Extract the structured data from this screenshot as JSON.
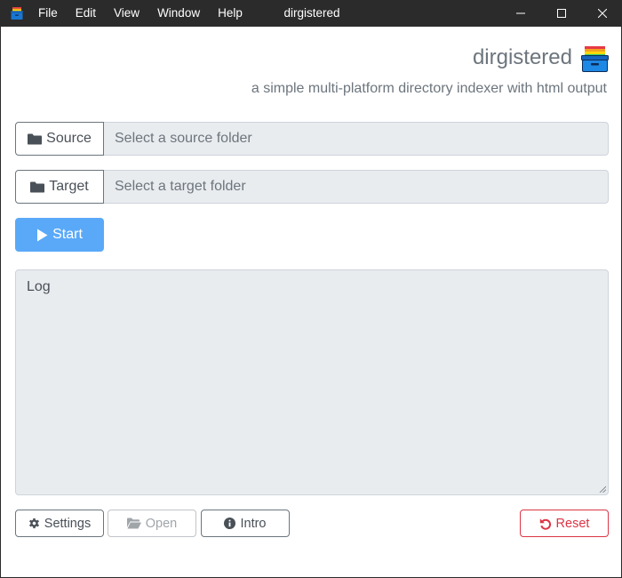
{
  "window": {
    "title": "dirgistered",
    "menu": [
      "File",
      "Edit",
      "View",
      "Window",
      "Help"
    ]
  },
  "header": {
    "app_name": "dirgistered",
    "subtitle": "a simple multi-platform directory indexer with html output"
  },
  "source": {
    "button_label": "Source",
    "placeholder": "Select a source folder"
  },
  "target": {
    "button_label": "Target",
    "placeholder": "Select a target folder"
  },
  "start": {
    "label": "Start"
  },
  "log": {
    "placeholder": "Log"
  },
  "footer": {
    "settings_label": "Settings",
    "open_label": "Open",
    "intro_label": "Intro",
    "reset_label": "Reset"
  },
  "colors": {
    "titlebar": "#2b2b2b",
    "primary": "#5aa9f8",
    "danger": "#dc3545",
    "muted": "#6c757d",
    "field_bg": "#e9ecef"
  }
}
